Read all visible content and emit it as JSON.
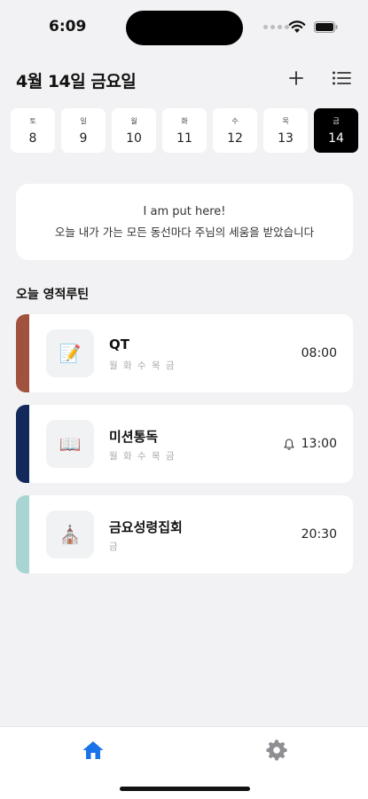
{
  "status_bar": {
    "time": "6:09"
  },
  "header": {
    "title": "4월 14일 금요일"
  },
  "date_strip": [
    {
      "dow": "토",
      "num": "8",
      "selected": false
    },
    {
      "dow": "일",
      "num": "9",
      "selected": false
    },
    {
      "dow": "월",
      "num": "10",
      "selected": false
    },
    {
      "dow": "화",
      "num": "11",
      "selected": false
    },
    {
      "dow": "수",
      "num": "12",
      "selected": false
    },
    {
      "dow": "목",
      "num": "13",
      "selected": false
    },
    {
      "dow": "금",
      "num": "14",
      "selected": true
    }
  ],
  "verse": {
    "line1": "I am put here!",
    "line2": "오늘 내가 가는 모든 동선마다 주님의 세움을 받았습니다"
  },
  "section": {
    "title": "오늘 영적루틴"
  },
  "routines": [
    {
      "name": "QT",
      "days": "월 화 수 목 금",
      "time": "08:00",
      "color": "#a0523f",
      "icon": "memo-icon",
      "glyph": "📝",
      "has_alarm": false
    },
    {
      "name": "미션통독",
      "days": "월 화 수 목 금",
      "time": "13:00",
      "color": "#13295c",
      "icon": "open-book-icon",
      "glyph": "📖",
      "has_alarm": true
    },
    {
      "name": "금요성령집회",
      "days": "금",
      "time": "20:30",
      "color": "#a9d4d4",
      "icon": "church-icon",
      "glyph": "⛪",
      "has_alarm": false
    }
  ],
  "tab_bar": {
    "active_color": "#1a73e8",
    "inactive_color": "#8e8e93"
  }
}
